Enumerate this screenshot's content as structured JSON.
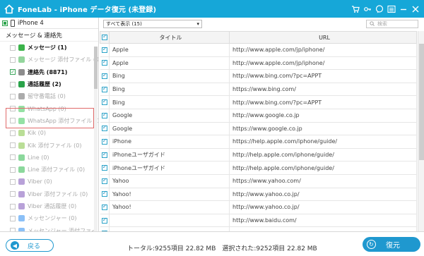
{
  "window": {
    "title": "FoneLab - iPhone データ復元 (未登録)"
  },
  "device": {
    "name": "iPhone 4"
  },
  "sidebar": {
    "section_title": "メッセージ & 連絡先",
    "items": [
      {
        "label": "メッセージ (1)",
        "style": "bold",
        "checked": false,
        "icon_color": "#3bb34a"
      },
      {
        "label": "メッセージ 添付ファイル (0)",
        "style": "dim",
        "checked": false,
        "icon_color": "#3bb34a"
      },
      {
        "label": "連絡先 (8871)",
        "style": "bold",
        "checked": true,
        "icon_color": "#8d8d8d"
      },
      {
        "label": "通話履歴 (2)",
        "style": "bold",
        "checked": false,
        "icon_color": "#2aa34a"
      },
      {
        "label": "留守番電話 (0)",
        "style": "dim",
        "checked": false,
        "icon_color": "#666666"
      },
      {
        "label": "WhatsApp (0)",
        "style": "dim",
        "checked": false,
        "icon_color": "#3cc85a"
      },
      {
        "label": "WhatsApp 添付ファイル (0)",
        "style": "dim",
        "checked": false,
        "icon_color": "#3cc85a"
      },
      {
        "label": "Kik (0)",
        "style": "dim",
        "checked": false,
        "icon_color": "#82c341"
      },
      {
        "label": "Kik 添付ファイル (0)",
        "style": "dim",
        "checked": false,
        "icon_color": "#82c341"
      },
      {
        "label": "Line (0)",
        "style": "dim",
        "checked": false,
        "icon_color": "#2cb84a"
      },
      {
        "label": "Line 添付ファイル (0)",
        "style": "dim",
        "checked": false,
        "icon_color": "#2cb84a"
      },
      {
        "label": "Viber (0)",
        "style": "dim",
        "checked": false,
        "icon_color": "#7d54b8"
      },
      {
        "label": "Viber 添付ファイル (0)",
        "style": "dim",
        "checked": false,
        "icon_color": "#7d54b8"
      },
      {
        "label": "Viber 通話履歴 (0)",
        "style": "dim",
        "checked": false,
        "icon_color": "#7d54b8"
      },
      {
        "label": "メッセンジャー (0)",
        "style": "dim",
        "checked": false,
        "icon_color": "#2b8cf0"
      },
      {
        "label": "メッセンジャー 添付ファイル (0)",
        "style": "dim",
        "checked": false,
        "icon_color": "#2b8cf0"
      }
    ]
  },
  "filter": {
    "selected": "すべて表示 (15)",
    "search_placeholder": "検索"
  },
  "table": {
    "columns": [
      "タイトル",
      "URL"
    ],
    "rows": [
      {
        "title": "Apple",
        "url": "http://www.apple.com/jp/iphone/"
      },
      {
        "title": "Apple",
        "url": "http://www.apple.com/jp/iphone/"
      },
      {
        "title": "Bing",
        "url": "http://www.bing.com/?pc=APPT"
      },
      {
        "title": "Bing",
        "url": "https://www.bing.com/"
      },
      {
        "title": "Bing",
        "url": "http://www.bing.com/?pc=APPT"
      },
      {
        "title": "Google",
        "url": "http://www.google.co.jp"
      },
      {
        "title": "Google",
        "url": "https://www.google.co.jp"
      },
      {
        "title": "iPhone",
        "url": "https://help.apple.com/iphone/guide/"
      },
      {
        "title": "iPhoneユーザガイド",
        "url": "http://help.apple.com/iphone/guide/"
      },
      {
        "title": "iPhoneユーザガイド",
        "url": "http://help.apple.com/iphone/guide/"
      },
      {
        "title": "Yahoo",
        "url": "https://www.yahoo.com/"
      },
      {
        "title": "Yahoo!",
        "url": "http://www.yahoo.co.jp/"
      },
      {
        "title": "Yahoo!",
        "url": "http://www.yahoo.co.jp/"
      },
      {
        "title": "",
        "url": "http://www.baidu.com/"
      },
      {
        "title": "",
        "url": ""
      }
    ]
  },
  "footer": {
    "back_label": "戻る",
    "status": "トータル:9255項目 22.82 MB　選択された:9252項目 22.82 MB",
    "restore_label": "復元"
  },
  "colors": {
    "titlebar": "#16a7d8",
    "accent": "#1f98cf"
  }
}
